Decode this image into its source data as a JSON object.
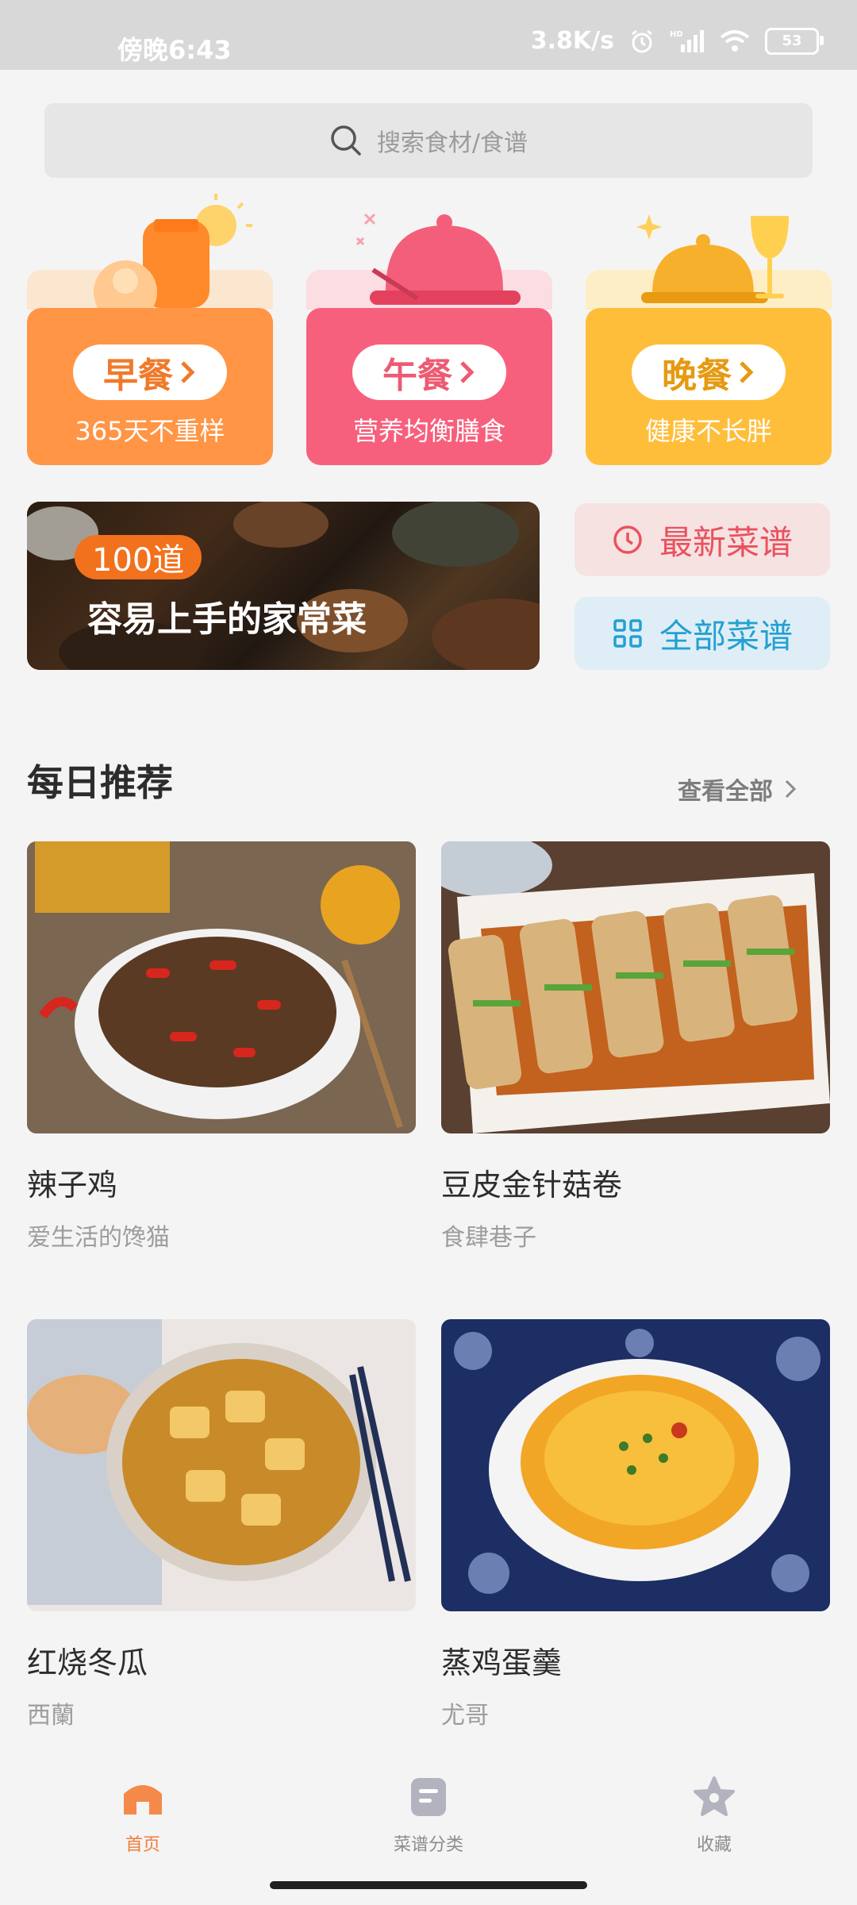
{
  "status": {
    "time": "傍晚6:43",
    "speed": "3.8K/s",
    "battery": "53",
    "icons": [
      "alarm-icon",
      "hd-signal-icon",
      "wifi-icon",
      "battery-icon"
    ]
  },
  "search": {
    "placeholder": "搜索食材/食谱"
  },
  "meals": [
    {
      "title": "早餐",
      "subtitle": "365天不重样",
      "color": "#ff9545",
      "icon": "juice-bottle-icon"
    },
    {
      "title": "午餐",
      "subtitle": "营养均衡膳食",
      "color": "#f7607c",
      "icon": "food-cloche-icon"
    },
    {
      "title": "晚餐",
      "subtitle": "健康不长胖",
      "color": "#ffbe3a",
      "icon": "wine-glass-icon"
    }
  ],
  "banner": {
    "badge": "100道",
    "title": "容易上手的家常菜"
  },
  "quick_links": [
    {
      "label": "最新菜谱",
      "icon": "clock-icon",
      "color": "#e9525e",
      "bg": "#f7e2e2"
    },
    {
      "label": "全部菜谱",
      "icon": "grid-icon",
      "color": "#23a0d3",
      "bg": "#dfeef6"
    }
  ],
  "daily": {
    "title": "每日推荐",
    "see_all": "查看全部",
    "recipes": [
      {
        "name": "辣子鸡",
        "author": "爱生活的馋猫"
      },
      {
        "name": "豆皮金针菇卷",
        "author": "食肆巷子"
      },
      {
        "name": "红烧冬瓜",
        "author": "西蘭"
      },
      {
        "name": "蒸鸡蛋羹",
        "author": "尤哥"
      }
    ]
  },
  "tabs": [
    {
      "label": "首页",
      "active": true
    },
    {
      "label": "菜谱分类",
      "active": false
    },
    {
      "label": "收藏",
      "active": false
    }
  ]
}
